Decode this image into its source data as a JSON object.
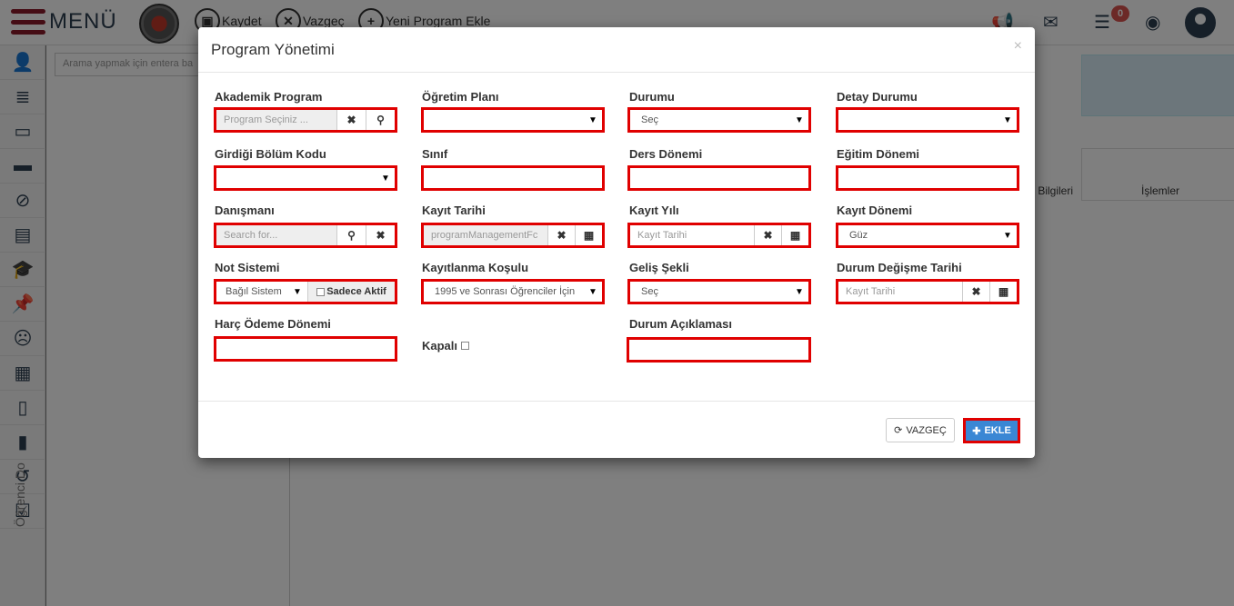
{
  "topbar": {
    "menu_label": "MENÜ",
    "save_label": "Kaydet",
    "cancel_label": "Vazgeç",
    "add_program_label": "Yeni Program Ekle",
    "notification_count": "0"
  },
  "sidebar": {
    "vertical_label": "Öğrenci Do"
  },
  "content": {
    "search_placeholder": "Arama yapmak için entera ba",
    "table_headers": [
      "lık Bilgileri",
      "İşlemler"
    ]
  },
  "modal": {
    "title": "Program Yönetimi",
    "close_glyph": "×",
    "fields": {
      "akademik_program": {
        "label": "Akademik Program",
        "placeholder": "Program Seçiniz ..."
      },
      "ogretim_plani": {
        "label": "Öğretim Planı",
        "value": ""
      },
      "durumu": {
        "label": "Durumu",
        "value": "Seç"
      },
      "detay_durumu": {
        "label": "Detay Durumu",
        "value": ""
      },
      "girdigi_bolum_kodu": {
        "label": "Girdiği Bölüm Kodu",
        "value": ""
      },
      "sinif": {
        "label": "Sınıf",
        "value": ""
      },
      "ders_donemi": {
        "label": "Ders Dönemi",
        "value": ""
      },
      "egitim_donemi": {
        "label": "Eğitim Dönemi",
        "value": ""
      },
      "danismani": {
        "label": "Danışmanı",
        "placeholder": "Search for..."
      },
      "kayit_tarihi": {
        "label": "Kayıt Tarihi",
        "value": "programManagementFc"
      },
      "kayit_yili": {
        "label": "Kayıt Yılı",
        "placeholder": "Kayıt Tarihi"
      },
      "kayit_donemi": {
        "label": "Kayıt Dönemi",
        "value": "Güz"
      },
      "not_sistemi": {
        "label": "Not Sistemi",
        "value": "Bağıl Sistem",
        "checkbox_label": "Sadece Aktif"
      },
      "kayitlanma_kosulu": {
        "label": "Kayıtlanma Koşulu",
        "value": "1995 ve Sonrası Öğrenciler İçin"
      },
      "gelis_sekli": {
        "label": "Geliş Şekli",
        "value": "Seç"
      },
      "durum_degisme_tarihi": {
        "label": "Durum Değişme Tarihi",
        "placeholder": "Kayıt Tarihi"
      },
      "harc_odeme_donemi": {
        "label": "Harç Ödeme Dönemi",
        "value": ""
      },
      "kapali": {
        "label": "Kapalı"
      },
      "durum_aciklamasi": {
        "label": "Durum Açıklaması",
        "value": ""
      }
    },
    "footer": {
      "cancel_label": "VAZGEÇ",
      "ok_label": "EKLE"
    }
  },
  "icons": {
    "clear": "✖",
    "search": "⚲",
    "calendar": "▦",
    "caret": "▼",
    "refresh": "⟳",
    "plus": "✚"
  },
  "colors": {
    "highlight": "#e00000",
    "primary_button": "#3a87d4",
    "brand": "#8b1a2b"
  }
}
